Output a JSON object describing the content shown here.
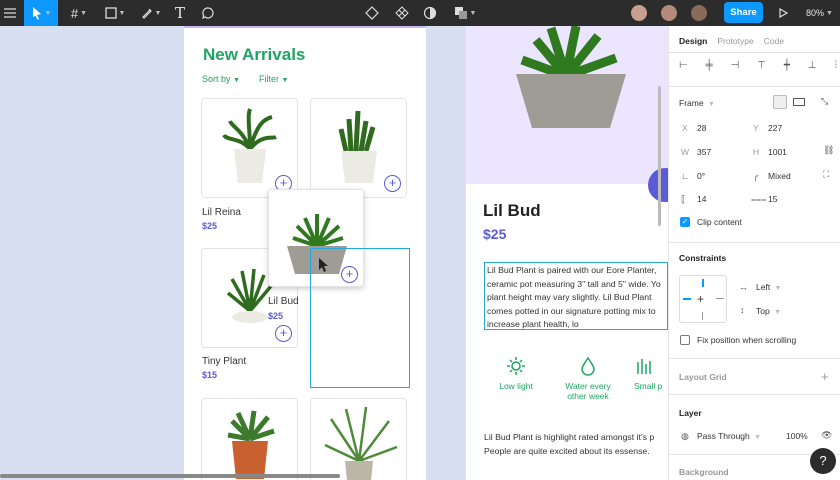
{
  "toolbar": {
    "share_label": "Share",
    "zoom": "80%"
  },
  "left_frame": {
    "title": "New Arrivals",
    "sort_label": "Sort by",
    "filter_label": "Filter",
    "products": [
      {
        "name": "Lil Reina",
        "price": "$25"
      },
      {
        "name": "Tiny Plant",
        "price": "$15"
      },
      {
        "name": "Lil Bud",
        "price": "$25"
      }
    ]
  },
  "detail_frame": {
    "title": "Lil Bud",
    "price": "$25",
    "description": "Lil Bud Plant is paired with our Eore Planter, ceramic pot measuring 3\" tall and 5\" wide. Yo plant height may vary slightly. Lil Bud Plant comes potted in our signature potting mix to increase plant health, lo",
    "features": [
      {
        "label": "Low light"
      },
      {
        "label": "Water every other week"
      },
      {
        "label": "Small p"
      }
    ],
    "highlight": "Lil Bud Plant is highlight rated amongst it's p People are quite excited about its essense."
  },
  "panel": {
    "tabs": [
      "Design",
      "Prototype",
      "Code"
    ],
    "frame_label": "Frame",
    "x": "28",
    "y": "227",
    "w": "357",
    "h": "1001",
    "rotation": "0°",
    "radius": "Mixed",
    "gap_h": "14",
    "gap_v": "15",
    "clip_content": "Clip content",
    "constraints_title": "Constraints",
    "constraint_h": "Left",
    "constraint_v": "Top",
    "fix_scroll": "Fix position when scrolling",
    "layout_grid": "Layout Grid",
    "layer_title": "Layer",
    "blend": "Pass Through",
    "opacity": "100%",
    "background_title": "Background",
    "labels": {
      "x": "X",
      "y": "Y",
      "w": "W",
      "h": "H"
    }
  },
  "colors": {
    "accent": "#0d99ff",
    "green": "#1fa463",
    "purple": "#5b5bd6"
  }
}
